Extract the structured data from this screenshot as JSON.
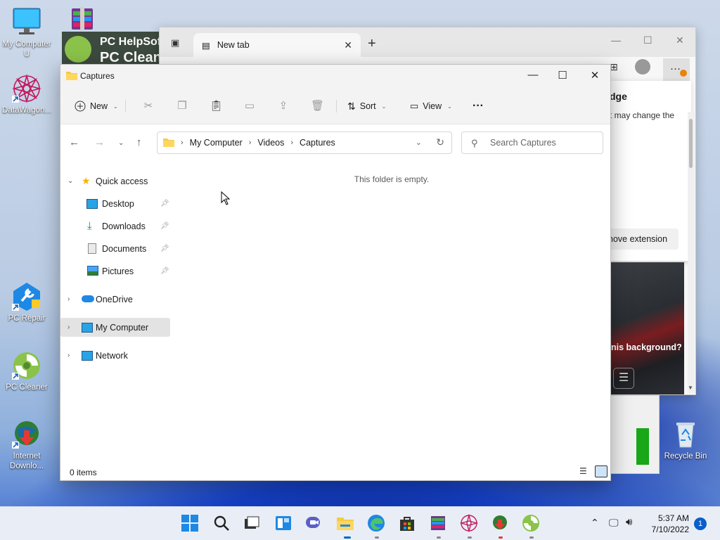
{
  "desktop": {
    "icons": [
      {
        "label": "My Computer U",
        "icon": "monitor-icon"
      },
      {
        "label": "DataWagon...",
        "icon": "datawagon-icon"
      },
      {
        "label": "PC Repair",
        "icon": "pc-repair-icon"
      },
      {
        "label": "PC Cleaner",
        "icon": "pc-cleaner-icon"
      },
      {
        "label": "Internet Downlo...",
        "icon": "internet-download-icon"
      },
      {
        "label": "Recycle Bin",
        "icon": "recycle-bin-icon"
      }
    ],
    "pc_helpsoft_banner": {
      "line1": "PC HelpSoft",
      "line2": "PC Clean"
    }
  },
  "browser": {
    "tab_title": "New tab",
    "panel_heading": "dge",
    "panel_text": "t may change the",
    "remove_extension": "nove extension",
    "news_question": "nis background?"
  },
  "explorer": {
    "window_title": "Captures",
    "commands": {
      "new": "New",
      "sort": "Sort",
      "view": "View",
      "more": "···"
    },
    "address": {
      "crumbs": [
        "My Computer",
        "Videos",
        "Captures"
      ]
    },
    "search_placeholder": "Search Captures",
    "nav": {
      "quick_access": "Quick access",
      "desktop": "Desktop",
      "downloads": "Downloads",
      "documents": "Documents",
      "pictures": "Pictures",
      "onedrive": "OneDrive",
      "my_computer": "My Computer",
      "network": "Network"
    },
    "empty_message": "This folder is empty.",
    "status": "0 items"
  },
  "taskbar": {
    "apps": [
      "start-icon",
      "search-icon",
      "task-view-icon",
      "widgets-icon",
      "chat-icon",
      "file-explorer-icon",
      "edge-icon",
      "store-icon",
      "winrar-icon",
      "datawagon-icon",
      "internet-download-icon",
      "pc-cleaner-icon"
    ],
    "time": "5:37 AM",
    "date": "7/10/2022",
    "notification_count": "1"
  },
  "colors": {
    "accent": "#0067c0",
    "selected_nav": "#e3e3e3",
    "folder": "#f7c945"
  }
}
